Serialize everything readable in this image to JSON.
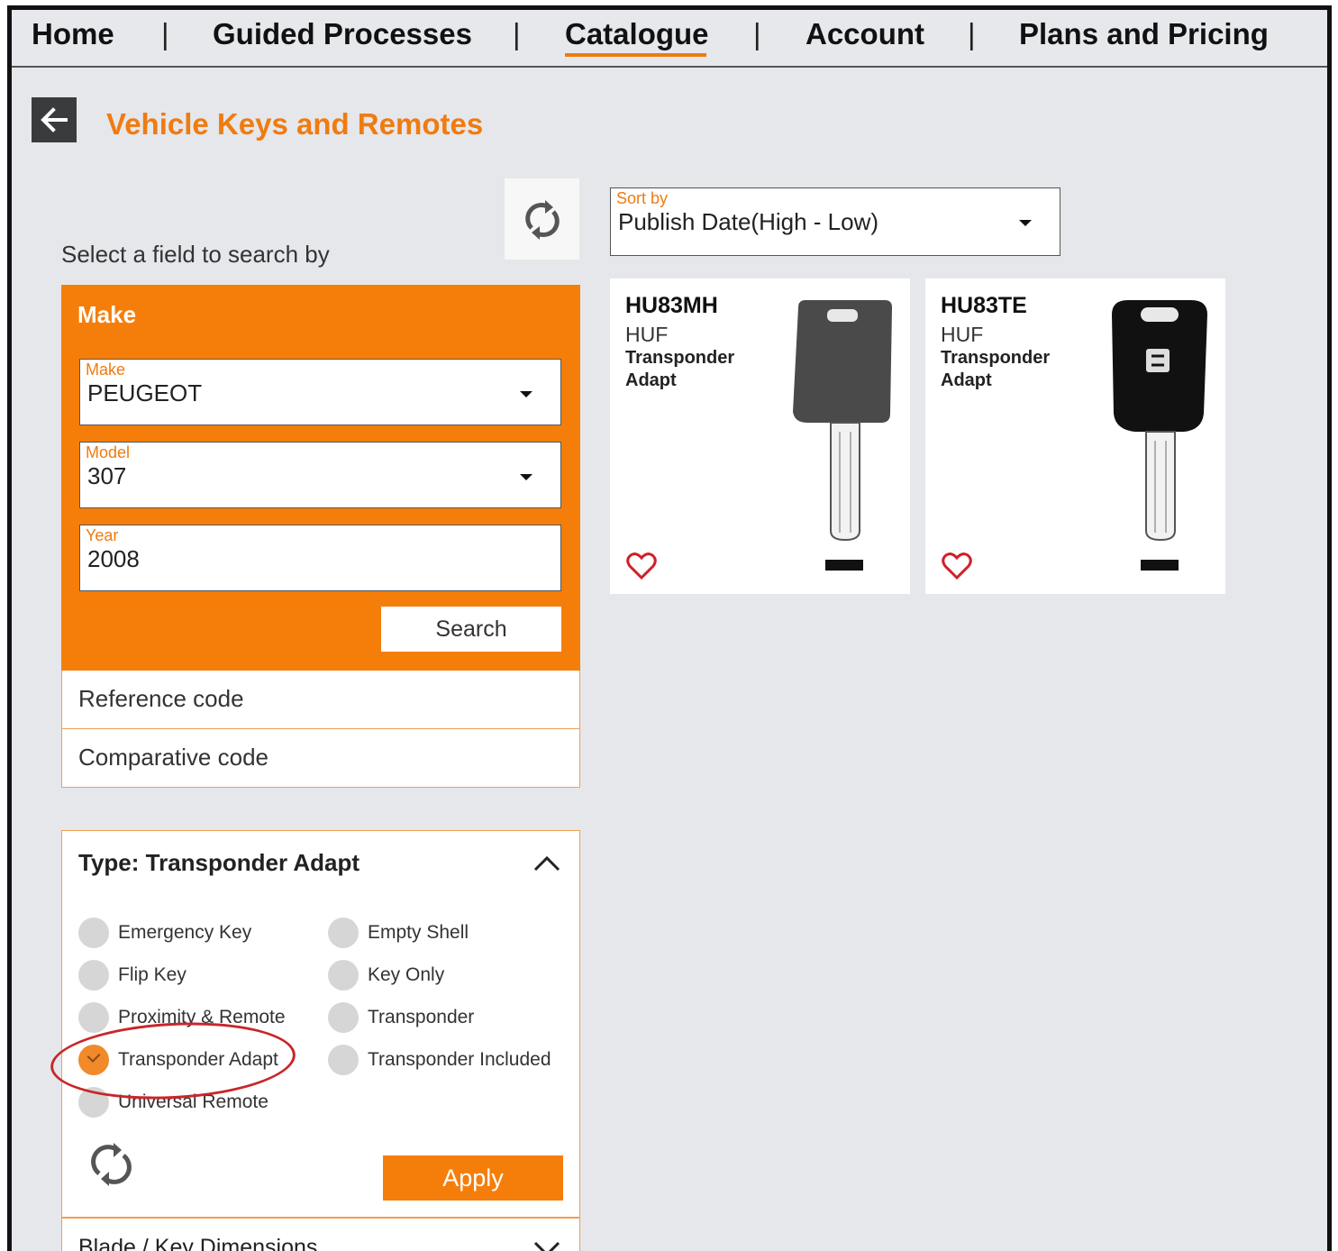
{
  "nav": {
    "items": [
      "Home",
      "Guided Processes",
      "Catalogue",
      "Account",
      "Plans and Pricing"
    ],
    "separator": "|",
    "active": "Catalogue"
  },
  "page": {
    "title": "Vehicle Keys and Remotes",
    "field_prompt": "Select a field to search by"
  },
  "sort": {
    "label": "Sort by",
    "value": "Publish Date(High - Low)"
  },
  "make_panel": {
    "header": "Make",
    "make": {
      "label": "Make",
      "value": "PEUGEOT"
    },
    "model": {
      "label": "Model",
      "value": "307"
    },
    "year": {
      "label": "Year",
      "value": "2008"
    },
    "search_label": "Search"
  },
  "alt_fields": [
    "Reference code",
    "Comparative code"
  ],
  "type_filter": {
    "header": "Type: Transponder Adapt",
    "options": [
      {
        "label": "Emergency Key",
        "checked": false
      },
      {
        "label": "Empty Shell",
        "checked": false
      },
      {
        "label": "Flip Key",
        "checked": false
      },
      {
        "label": "Key Only",
        "checked": false
      },
      {
        "label": "Proximity & Remote",
        "checked": false
      },
      {
        "label": "Transponder",
        "checked": false
      },
      {
        "label": "Transponder Adapt",
        "checked": true
      },
      {
        "label": "Transponder Included",
        "checked": false
      },
      {
        "label": "Universal Remote",
        "checked": false
      }
    ],
    "apply_label": "Apply"
  },
  "dimensions_filter": {
    "header": "Blade / Key Dimensions"
  },
  "products": [
    {
      "code": "HU83MH",
      "brand": "HUF",
      "type": "Transponder Adapt",
      "head_color": "#4a4a4a"
    },
    {
      "code": "HU83TE",
      "brand": "HUF",
      "type": "Transponder Adapt",
      "head_color": "#111111"
    }
  ],
  "colors": {
    "accent": "#f57e0a",
    "highlight": "#c8262a",
    "background": "#e6e7eb"
  }
}
